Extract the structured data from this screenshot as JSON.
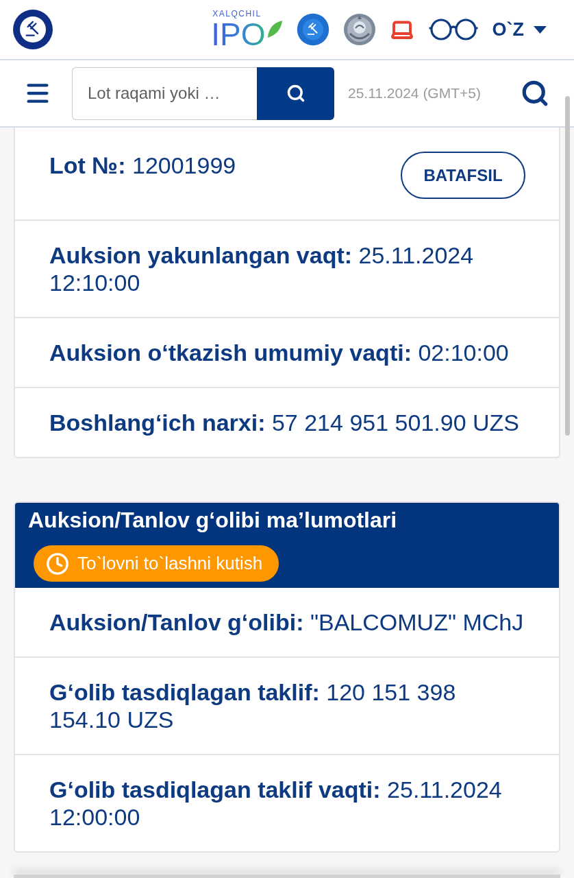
{
  "header": {
    "ipo_logo": {
      "caption": "XALQCHIL",
      "text": "IPO"
    },
    "language": "O`Z"
  },
  "toolbar": {
    "search": {
      "placeholder": "Lot raqami yoki …"
    },
    "date": "25.11.2024 (GMT+5)"
  },
  "lot_card": {
    "lot": {
      "text": "**Lot №:** 12001999",
      "button": "BATAFSIL"
    },
    "rows": [
      {
        "text": "**Auksion yakunlangan vaqt:** 25.11.2024 12:10:00"
      },
      {
        "text": "**Auksion o‘tkazish umumiy vaqti:** 02:10:00"
      },
      {
        "text": "**Boshlang‘ich narxi:** 57 214 951 501.90 UZS"
      }
    ]
  },
  "winner_card": {
    "title": "Auksion/Tanlov g‘olibi ma’lumotlari",
    "status": {
      "text": "To`lovni to`lashni kutish",
      "color": "#ff9800"
    },
    "rows": [
      {
        "text": "**Auksion/Tanlov g‘olibi:** \"BALCOMUZ\" MChJ"
      },
      {
        "text": "**G‘olib tasdiqlagan taklif:** 120 151 398 154.10 UZS"
      },
      {
        "text": "**G‘olib tasdiqlagan taklif vaqti:** 25.11.2024 12:00:00"
      }
    ]
  }
}
